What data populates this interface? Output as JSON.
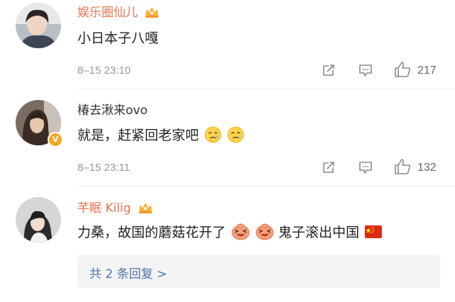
{
  "comments": [
    {
      "username": "娱乐圈仙儿",
      "text": "小日本子八嘎",
      "time": "8–15 23:10",
      "likes": "217",
      "avatar_icon": "user-avatar",
      "badge": "crown-icon",
      "name_color": "#eb7350"
    },
    {
      "username": "椿去湫来ovo",
      "text": "就是，赶紧回老家吧",
      "emojis": [
        "sad-face-icon",
        "sad-face-icon"
      ],
      "time": "8–15 23:11",
      "likes": "132",
      "avatar_icon": "user-avatar",
      "badge": "verified-v-icon",
      "name_color": "#333333"
    },
    {
      "username": "芊眠 Kilig",
      "text": "力桑，故国的蘑菇花开了",
      "emojis": [
        "laughing-face-icon",
        "laughing-face-icon"
      ],
      "text_after": "鬼子滚出中国",
      "flag": "china-flag-icon",
      "avatar_icon": "user-avatar",
      "badge": "crown-icon",
      "name_color": "#eb7350",
      "replies_link": "共 2 条回复 >"
    }
  ],
  "accent_color": "#eb7350",
  "link_color": "#4c75a8"
}
